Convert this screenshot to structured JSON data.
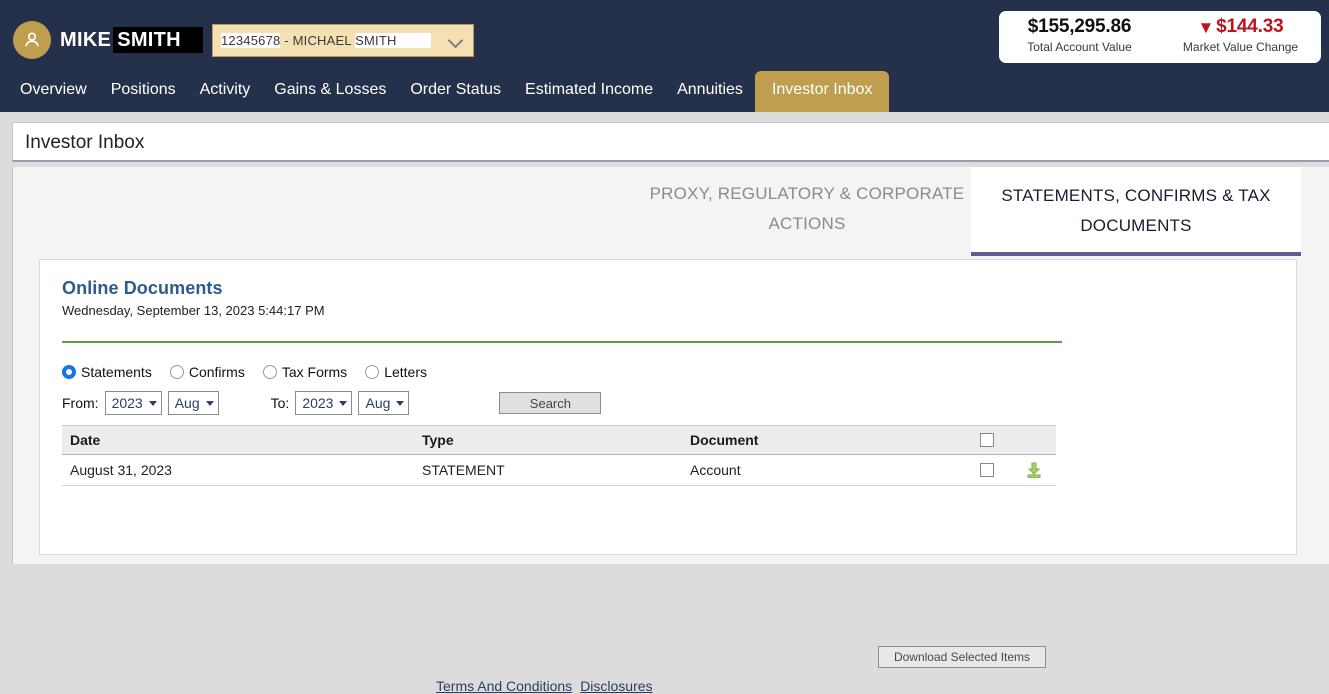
{
  "header": {
    "user_name_visible": "MIKE",
    "user_name_redacted": "SMITH",
    "account_number": "12345678",
    "account_separator": " - ",
    "account_owner_first": "MICHAEL",
    "account_owner_last": "SMITH",
    "avatar_icon": "person-icon",
    "dropdown_icon": "chevron-down-icon"
  },
  "value_summary": {
    "total_amount": "$155,295.86",
    "total_label": "Total Account Value",
    "change_arrow": "↓",
    "change_amount": "$144.33",
    "change_label": "Market Value Change",
    "change_color": "#c0131b"
  },
  "nav": {
    "items": [
      {
        "label": "Overview",
        "active": false
      },
      {
        "label": "Positions",
        "active": false
      },
      {
        "label": "Activity",
        "active": false
      },
      {
        "label": "Gains & Losses",
        "active": false
      },
      {
        "label": "Order Status",
        "active": false
      },
      {
        "label": "Estimated Income",
        "active": false
      },
      {
        "label": "Annuities",
        "active": false
      },
      {
        "label": "Investor Inbox",
        "active": true
      }
    ],
    "active_color": "#bf9e4f",
    "bar_color": "#25314a"
  },
  "page": {
    "title": "Investor Inbox"
  },
  "tabs": {
    "inactive_label": "PROXY, REGULATORY & CORPORATE ACTIONS",
    "active_label": "STATEMENTS, CONFIRMS & TAX DOCUMENTS",
    "active_underline_color": "#615d91"
  },
  "documents": {
    "heading": "Online Documents",
    "heading_color": "#2e5b8c",
    "timestamp": "Wednesday, September 13, 2023 5:44:17 PM",
    "divider_color": "#5e9a4e",
    "doc_types": [
      {
        "label": "Statements",
        "selected": true
      },
      {
        "label": "Confirms",
        "selected": false
      },
      {
        "label": "Tax Forms",
        "selected": false
      },
      {
        "label": "Letters",
        "selected": false
      }
    ],
    "filters": {
      "from_label": "From:",
      "from_year": "2023",
      "from_month": "Aug",
      "to_label": "To:",
      "to_year": "2023",
      "to_month": "Aug",
      "search_label": "Search"
    },
    "table": {
      "columns": [
        "Date",
        "Type",
        "Document"
      ],
      "select_all_checked": false,
      "rows": [
        {
          "date": "August 31, 2023",
          "type": "STATEMENT",
          "document": "Account",
          "checked": false,
          "download_icon": "download-icon"
        }
      ]
    },
    "download_button": "Download Selected Items",
    "footer_links": [
      {
        "label": "Terms And Conditions"
      },
      {
        "label": "Disclosures"
      }
    ]
  }
}
